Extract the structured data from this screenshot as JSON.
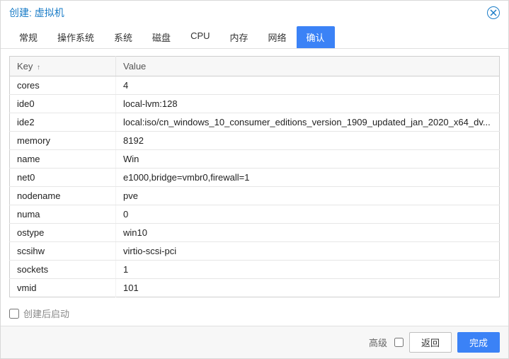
{
  "dialog": {
    "title": "创建: 虚拟机"
  },
  "tabs": [
    {
      "label": "常规",
      "active": false
    },
    {
      "label": "操作系统",
      "active": false
    },
    {
      "label": "系统",
      "active": false
    },
    {
      "label": "磁盘",
      "active": false
    },
    {
      "label": "CPU",
      "active": false
    },
    {
      "label": "内存",
      "active": false
    },
    {
      "label": "网络",
      "active": false
    },
    {
      "label": "确认",
      "active": true
    }
  ],
  "table": {
    "headers": {
      "key": "Key",
      "sort_indicator": "↑",
      "value": "Value"
    },
    "rows": [
      {
        "key": "cores",
        "value": "4"
      },
      {
        "key": "ide0",
        "value": "local-lvm:128"
      },
      {
        "key": "ide2",
        "value": "local:iso/cn_windows_10_consumer_editions_version_1909_updated_jan_2020_x64_dv..."
      },
      {
        "key": "memory",
        "value": "8192"
      },
      {
        "key": "name",
        "value": "Win"
      },
      {
        "key": "net0",
        "value": "e1000,bridge=vmbr0,firewall=1"
      },
      {
        "key": "nodename",
        "value": "pve"
      },
      {
        "key": "numa",
        "value": "0"
      },
      {
        "key": "ostype",
        "value": "win10"
      },
      {
        "key": "scsihw",
        "value": "virtio-scsi-pci"
      },
      {
        "key": "sockets",
        "value": "1"
      },
      {
        "key": "vmid",
        "value": "101"
      }
    ]
  },
  "start_after_create": {
    "label": "创建后启动",
    "checked": false
  },
  "footer": {
    "advanced_label": "高级",
    "advanced_checked": false,
    "back_label": "返回",
    "finish_label": "完成"
  }
}
